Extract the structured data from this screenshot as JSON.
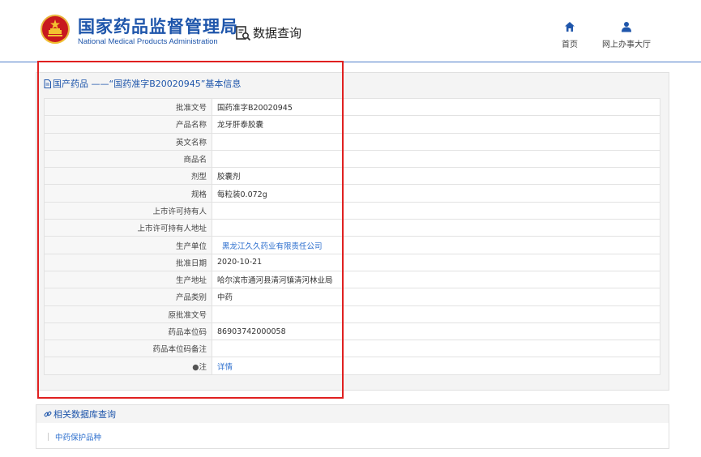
{
  "header": {
    "logo_cn": "国家药品监督管理局",
    "logo_en": "National Medical Products Administration",
    "query_label": "数据查询",
    "nav": [
      {
        "label": "首页",
        "icon": "home-icon"
      },
      {
        "label": "网上办事大厅",
        "icon": "user-icon"
      }
    ]
  },
  "detail": {
    "title": "国产药品 ——“国药准字B20020945”基本信息",
    "rows": [
      {
        "key": "批准文号",
        "value": "国药准字B20020945"
      },
      {
        "key": "产品名称",
        "value": "龙牙肝泰胶囊"
      },
      {
        "key": "英文名称",
        "value": ""
      },
      {
        "key": "商品名",
        "value": ""
      },
      {
        "key": "剂型",
        "value": "胶囊剂"
      },
      {
        "key": "规格",
        "value": "每粒装0.072g"
      },
      {
        "key": "上市许可持有人",
        "value": ""
      },
      {
        "key": "上市许可持有人地址",
        "value": ""
      },
      {
        "key": "生产单位",
        "value": "黑龙江久久药业有限责任公司"
      },
      {
        "key": "批准日期",
        "value": "2020-10-21"
      },
      {
        "key": "生产地址",
        "value": "哈尔滨市通河县清河镇清河林业局"
      },
      {
        "key": "产品类别",
        "value": "中药"
      },
      {
        "key": "原批准文号",
        "value": ""
      },
      {
        "key": "药品本位码",
        "value": "86903742000058"
      },
      {
        "key": "药品本位码备注",
        "value": ""
      },
      {
        "key": "注",
        "value": "详情"
      }
    ]
  },
  "related": {
    "title": "相关数据库查询",
    "link": "中药保护品种"
  },
  "colors": {
    "brand_blue": "#1f56ab",
    "link_blue": "#2d6fce",
    "highlight_red": "#e02020"
  }
}
